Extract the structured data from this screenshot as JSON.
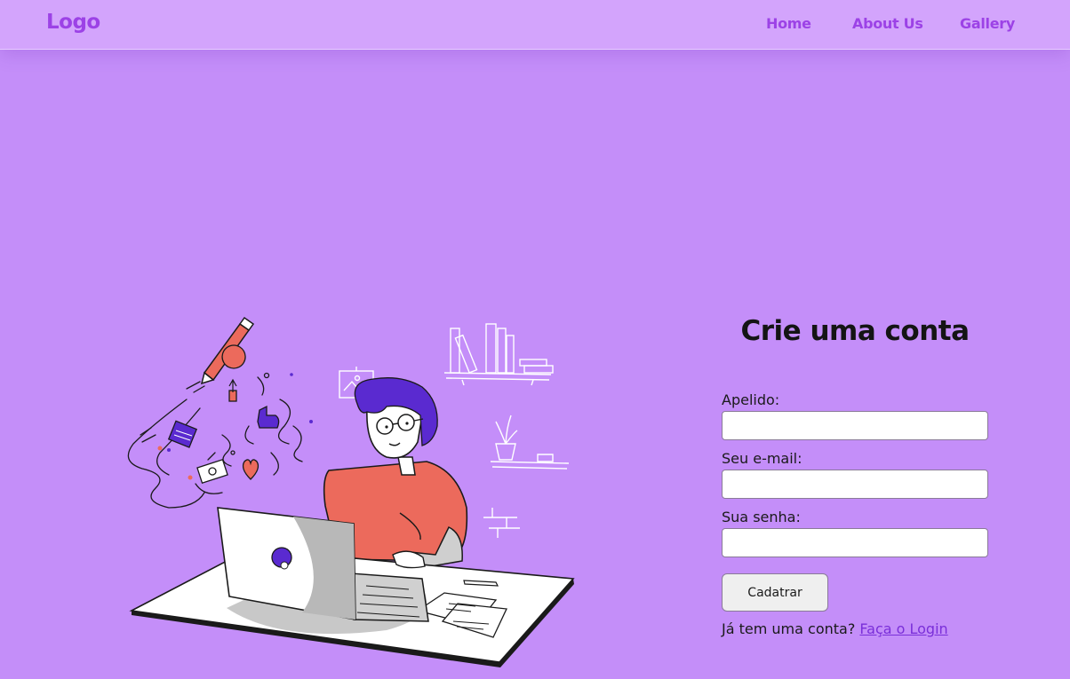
{
  "navbar": {
    "logo": "Logo",
    "links": [
      {
        "label": "Home"
      },
      {
        "label": "About Us"
      },
      {
        "label": "Gallery"
      }
    ]
  },
  "form": {
    "title": "Crie uma conta",
    "fields": [
      {
        "label": "Apelido:",
        "value": ""
      },
      {
        "label": "Seu e-mail:",
        "value": ""
      },
      {
        "label": "Sua senha:",
        "value": ""
      }
    ],
    "submit_label": "Cadatrar",
    "login_prompt": "Já tem uma conta?",
    "login_link": "Faça o Login"
  },
  "colors": {
    "background": "#c48ef9",
    "navbar": "#d3a4fc",
    "brand": "#9c42e6",
    "shirt": "#ec6a5c",
    "hair": "#5a2ad0"
  },
  "illustration": {
    "description_icon": "person-at-laptop-illustration"
  }
}
